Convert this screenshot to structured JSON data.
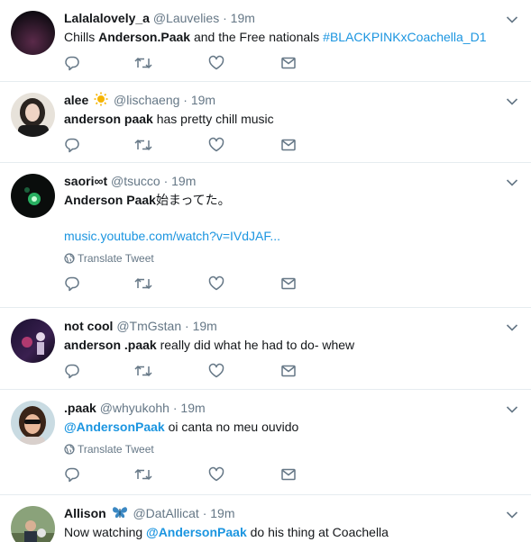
{
  "tweets": [
    {
      "name": "Lalalalovely_a",
      "handle": "@Lauvelies",
      "sep": "·",
      "time": "19m",
      "text_parts": [
        "Chills ",
        "Anderson.Paak",
        " and the Free nationals ",
        "#BLACKPINKxCoachella_D1"
      ]
    },
    {
      "name": "alee",
      "handle": "@lischaeng",
      "sep": "·",
      "time": "19m",
      "text_parts": [
        "anderson paak",
        " has pretty chill music"
      ]
    },
    {
      "name": "saori∞t",
      "handle": "@tsucco",
      "sep": "·",
      "time": "19m",
      "text_parts": [
        "Anderson Paak",
        "始まってた。"
      ],
      "link": "music.youtube.com/watch?v=IVdJAF...",
      "translate": "Translate Tweet"
    },
    {
      "name": "not cool",
      "handle": "@TmGstan",
      "sep": "·",
      "time": "19m",
      "text_parts": [
        "anderson .paak",
        " really did what he had to do- whew"
      ]
    },
    {
      "name": ".paak",
      "handle": "@whyukohh",
      "sep": "·",
      "time": "19m",
      "text_parts": [
        "@AndersonPaak",
        " oi canta no meu ouvido"
      ],
      "translate": "Translate Tweet"
    },
    {
      "name": "Allison",
      "handle": "@DatAllicat",
      "sep": "·",
      "time": "19m",
      "text_parts": [
        "Now watching ",
        "@AndersonPaak",
        " do his thing at Coachella"
      ]
    }
  ],
  "icons": {
    "reply": "reply-icon",
    "retweet": "retweet-icon",
    "like": "heart-icon",
    "dm": "envelope-icon",
    "caret": "chevron-down-icon",
    "globe": "globe-icon"
  },
  "colors": {
    "link": "#1b95e0",
    "muted": "#657786",
    "text": "#14171a",
    "border": "#e6ecf0"
  }
}
